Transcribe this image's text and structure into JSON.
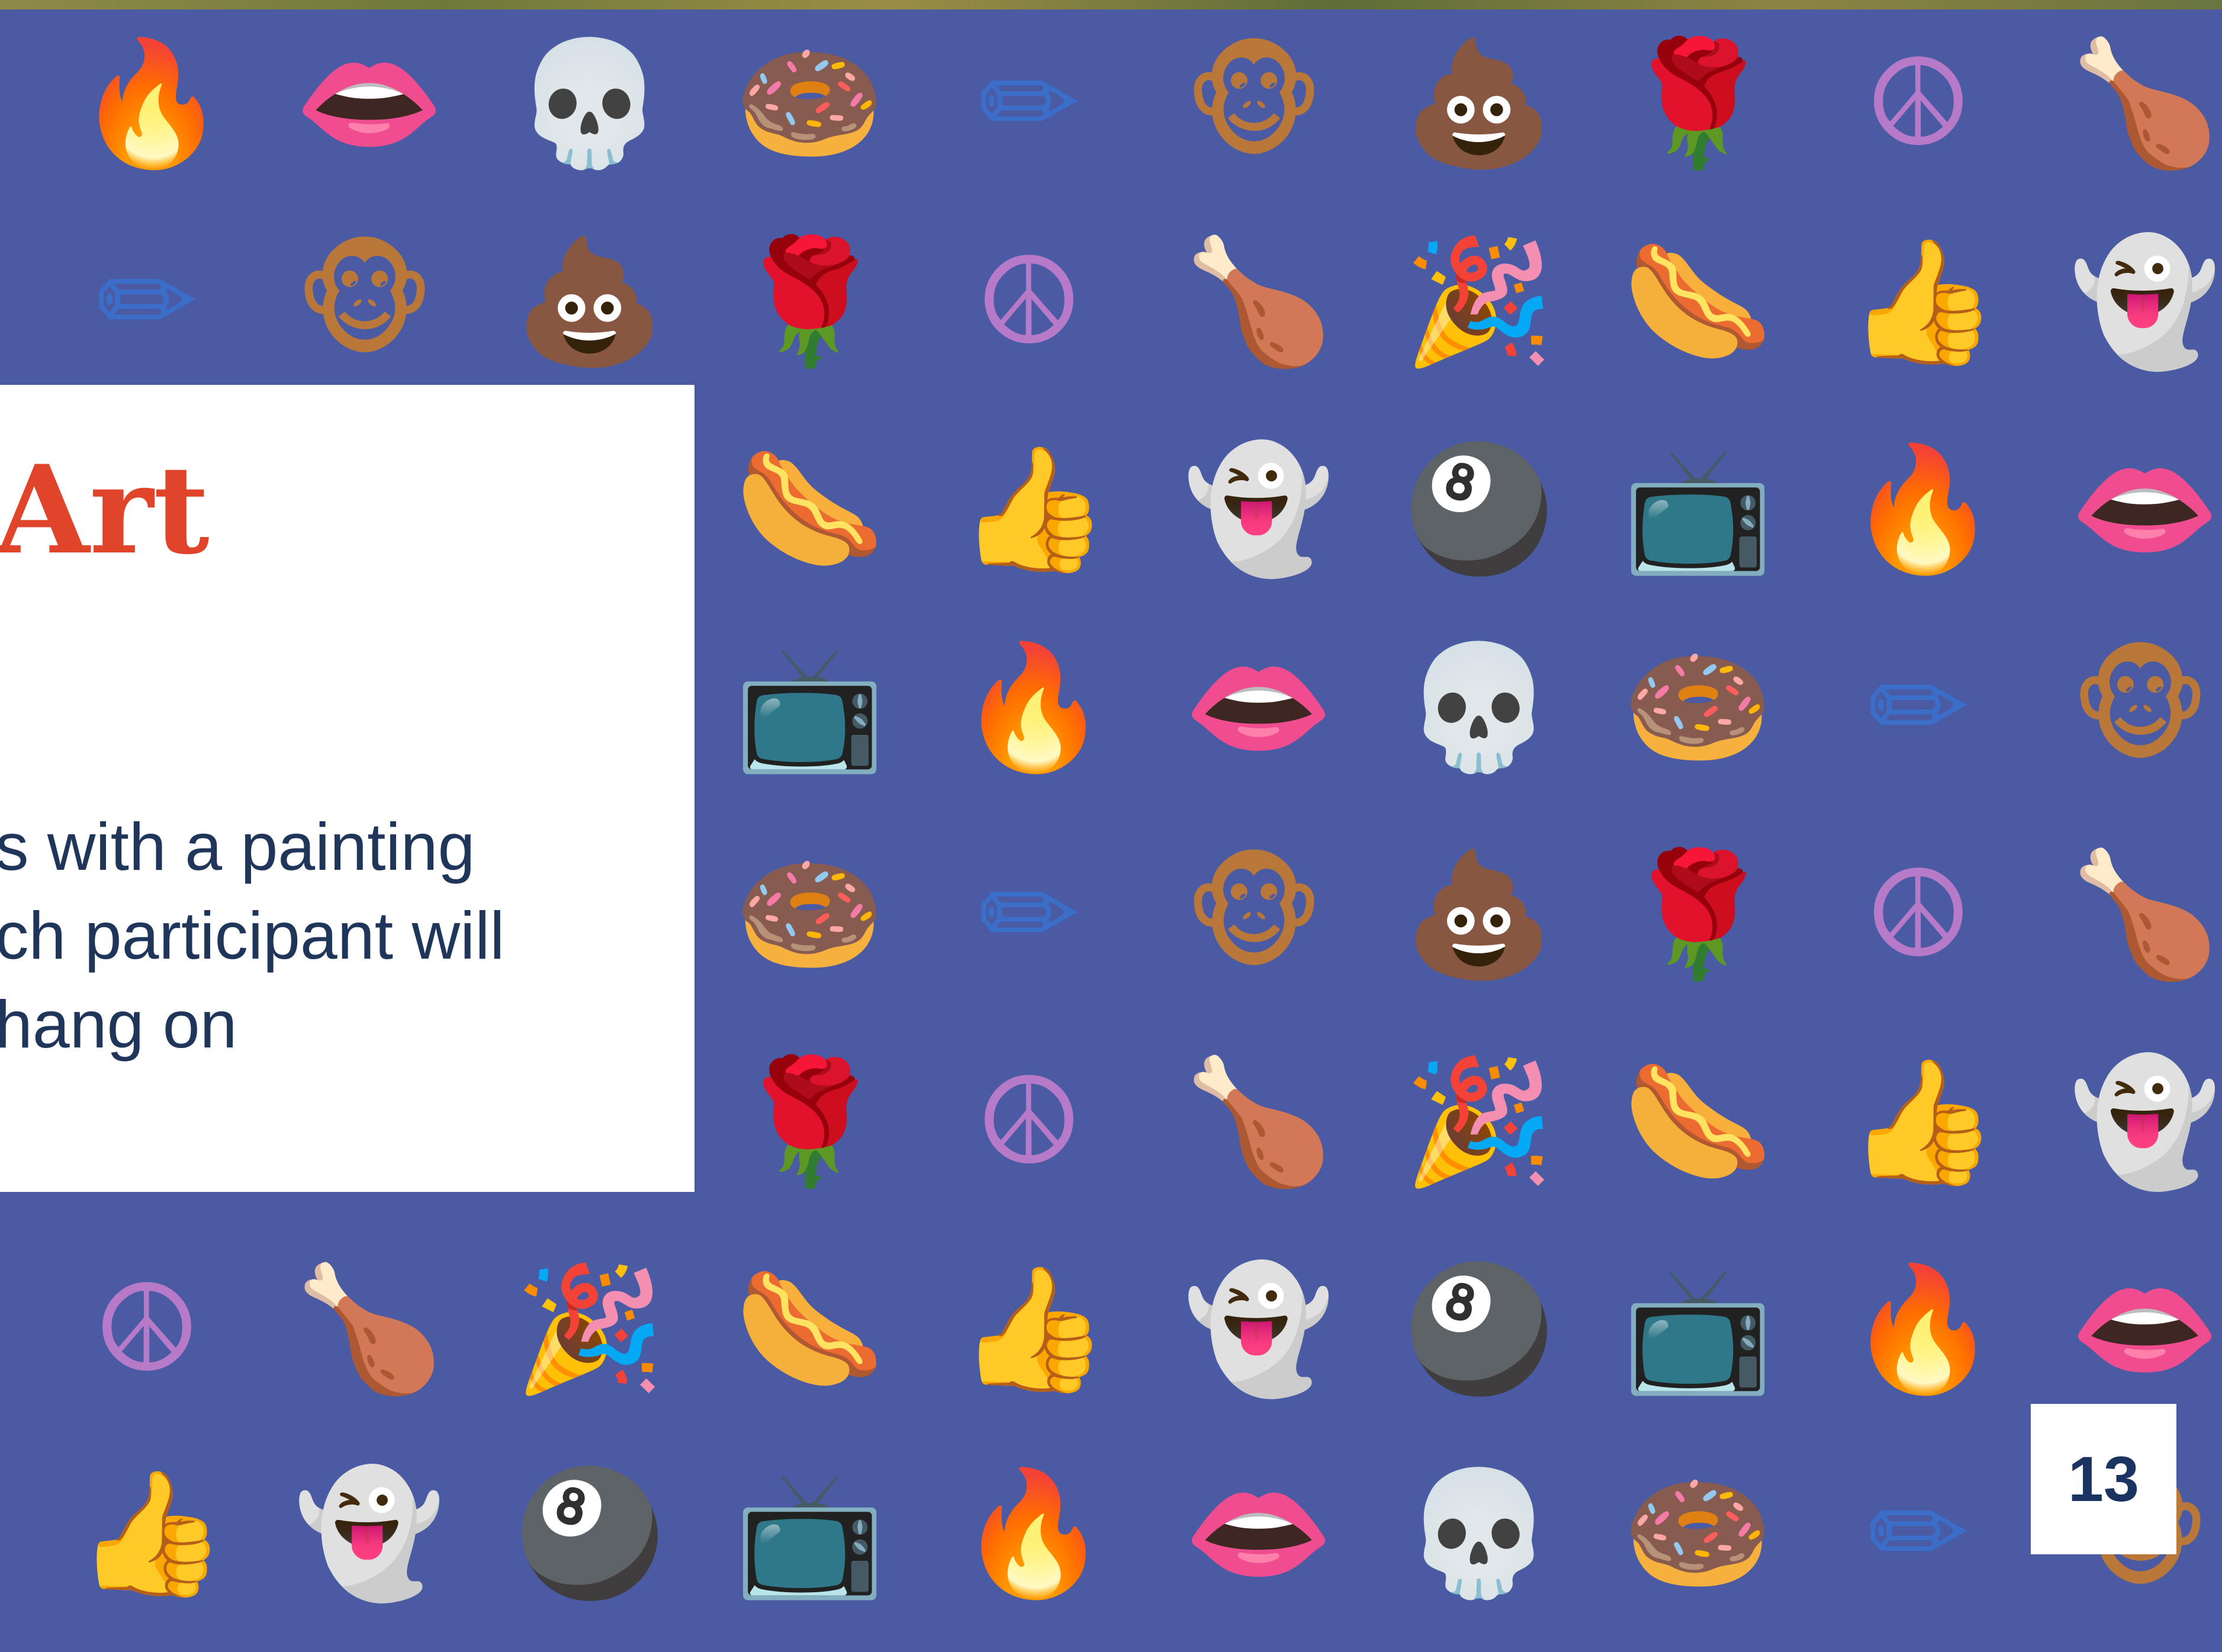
{
  "card": {
    "title": "Art",
    "body_lines": [
      "s with a painting",
      "ch participant will",
      " hang on"
    ]
  },
  "page": {
    "number": "13"
  },
  "pattern": {
    "background_color": "#4a5aa3",
    "rows": [
      [
        "fire",
        "lips",
        "skull",
        "donut",
        "pencil",
        "monkey",
        "poop",
        "rose",
        "peace",
        "drumstick"
      ],
      [
        "pencil",
        "monkey",
        "poop",
        "rose",
        "peace",
        "drumstick",
        "party-popper",
        "hotdog",
        "thumbs-up",
        "ghost"
      ],
      [
        "hotdog",
        "thumbs-up",
        "ghost",
        "8-ball",
        "tv",
        "fire",
        "lips"
      ],
      [
        "tv",
        "fire",
        "lips",
        "skull",
        "donut",
        "pencil",
        "monkey"
      ],
      [
        "donut",
        "pencil",
        "monkey",
        "poop",
        "rose",
        "peace",
        "drumstick"
      ],
      [
        "rose",
        "peace",
        "drumstick",
        "party-popper",
        "hotdog",
        "thumbs-up",
        "ghost"
      ],
      [
        "peace",
        "drumstick",
        "party-popper",
        "hotdog",
        "thumbs-up",
        "ghost",
        "8-ball",
        "tv",
        "fire",
        "lips"
      ],
      [
        "thumbs-up",
        "ghost",
        "8-ball",
        "tv",
        "fire",
        "lips",
        "skull",
        "donut",
        "pencil",
        "monkey"
      ]
    ]
  }
}
